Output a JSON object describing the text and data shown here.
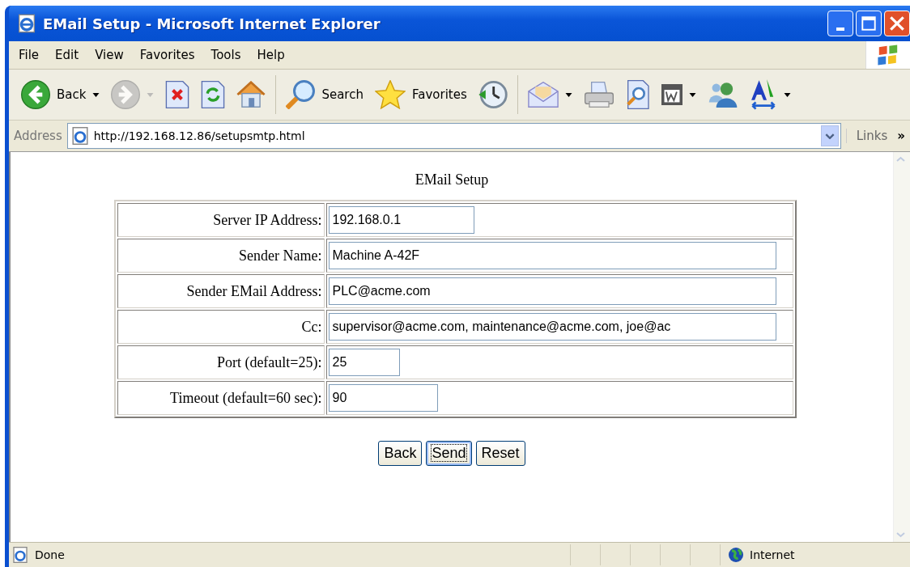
{
  "window": {
    "title": "EMail Setup - Microsoft Internet Explorer"
  },
  "menu": [
    "File",
    "Edit",
    "View",
    "Favorites",
    "Tools",
    "Help"
  ],
  "toolbar": [
    {
      "kind": "back",
      "label": "Back",
      "dropdown": true,
      "disabled": false
    },
    {
      "kind": "forward",
      "dropdown": true,
      "disabled": true
    },
    {
      "kind": "stop",
      "dropdown": false,
      "disabled": false
    },
    {
      "kind": "refresh",
      "dropdown": false,
      "disabled": false
    },
    {
      "kind": "home",
      "dropdown": false,
      "disabled": false
    },
    {
      "kind": "sep"
    },
    {
      "kind": "search",
      "label": "Search",
      "dropdown": false,
      "disabled": false
    },
    {
      "kind": "favorites",
      "label": "Favorites",
      "dropdown": false,
      "disabled": false
    },
    {
      "kind": "history",
      "dropdown": false,
      "disabled": false
    },
    {
      "kind": "sep"
    },
    {
      "kind": "mail",
      "dropdown": true,
      "disabled": false
    },
    {
      "kind": "print",
      "dropdown": false,
      "disabled": false
    },
    {
      "kind": "preview",
      "dropdown": false,
      "disabled": false
    },
    {
      "kind": "word",
      "dropdown": true,
      "disabled": false
    },
    {
      "kind": "messenger",
      "dropdown": false,
      "disabled": false
    },
    {
      "kind": "font",
      "dropdown": true,
      "disabled": false
    }
  ],
  "address_bar": {
    "label": "Address",
    "url": "http://192.168.12.86/setupsmtp.html",
    "links": "Links",
    "more": "»"
  },
  "page": {
    "heading": "EMail Setup",
    "rows": [
      {
        "label": "Server IP Address:",
        "value": "192.168.0.1"
      },
      {
        "label": "Sender Name:",
        "value": "Machine A-42F"
      },
      {
        "label": "Sender EMail Address:",
        "value": "PLC@acme.com"
      },
      {
        "label": "Cc:",
        "value": "supervisor@acme.com, maintenance@acme.com, joe@ac"
      },
      {
        "label": "Port (default=25):",
        "value": "25"
      },
      {
        "label": "Timeout (default=60 sec):",
        "value": "90"
      }
    ],
    "buttons": [
      {
        "label": "Back",
        "focused": false
      },
      {
        "label": "Send",
        "focused": true
      },
      {
        "label": "Reset",
        "focused": false
      }
    ]
  },
  "status_bar": {
    "text": "Done",
    "zone": "Internet"
  }
}
